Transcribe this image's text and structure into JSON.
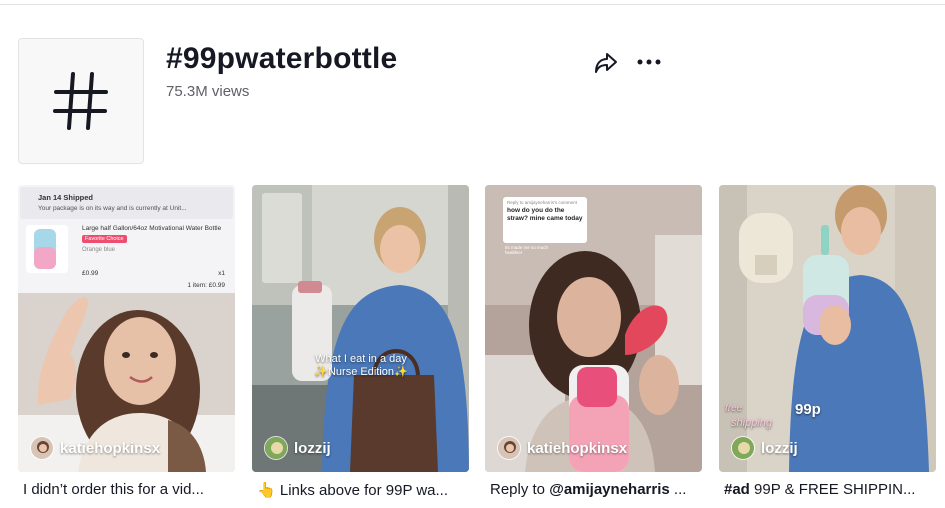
{
  "header": {
    "title": "#99pwaterbottle",
    "views": "75.3M views",
    "tag_symbol": "#"
  },
  "icons": {
    "share": "share-arrow-icon",
    "more": "more-dots-icon",
    "tag": "hashtag-icon"
  },
  "videos": [
    {
      "author": "katiehopkinsx",
      "caption": "I didn’t order this for a vid...",
      "caption_emoji": "",
      "caption_bold": "",
      "shipping": {
        "head": "Jan 14 Shipped",
        "sub": "Your package is on its way and is currently at Unit...",
        "product": "Large half Gallon/64oz Motivational Water Bottle",
        "badge": "Favorite Choice",
        "variant": "Orange blue",
        "price": "£0.99",
        "qty": "x1",
        "total": "1 item: £0.99"
      }
    },
    {
      "author": "lozzij",
      "caption": "Links above for 99P wa...",
      "caption_emoji": "👆",
      "caption_bold": "",
      "overlay_line1": "What I eat in a day",
      "overlay_line2": "✨Nurse Edition✨"
    },
    {
      "author": "katiehopkinsx",
      "caption": " ...",
      "caption_prefix": "Reply to ",
      "caption_bold": "@amijayneharris",
      "comment_top": "Reply to amijayneharris's comment",
      "comment_main": "how do you do the straw? mine came today",
      "comment_sub": "Its made me so much healthier"
    },
    {
      "author": "lozzij",
      "caption": " 99P & FREE SHIPPIN...",
      "caption_bold": "#ad",
      "overlay_price": "99p",
      "overlay_free": "free",
      "overlay_shipping": "shipping"
    }
  ],
  "colors": {
    "text": "#161823",
    "muted": "#5f6068",
    "border": "#e3e3e4"
  }
}
